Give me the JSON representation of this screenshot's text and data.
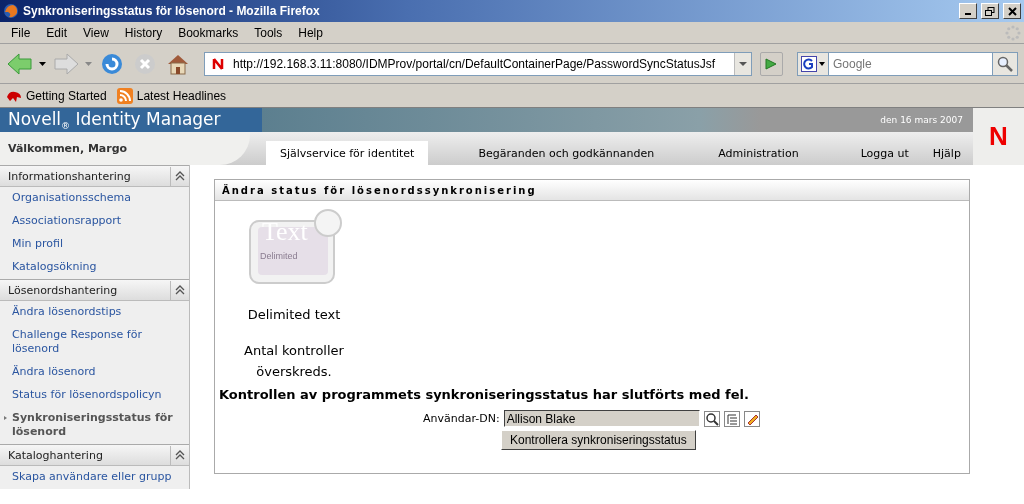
{
  "window": {
    "title": "Synkroniseringsstatus för lösenord - Mozilla Firefox"
  },
  "menu": [
    "File",
    "Edit",
    "View",
    "History",
    "Bookmarks",
    "Tools",
    "Help"
  ],
  "address": {
    "value": "http://192.168.3.11:8080/IDMProv/portal/cn/DefaultContainerPage/PasswordSyncStatusJsf"
  },
  "search": {
    "placeholder": "Google"
  },
  "bookmarks": [
    "Getting Started",
    "Latest Headlines"
  ],
  "header": {
    "product": "Novell$_{®}$ Identity Manager",
    "date": "den 16 mars 2007",
    "logo": "N"
  },
  "welcome": "Välkommen, Margo",
  "tabs": [
    {
      "label": "Självservice för identitet",
      "selected": true
    },
    {
      "label": "Begäranden och godkännanden",
      "selected": false
    },
    {
      "label": "Administration",
      "selected": false
    }
  ],
  "links": [
    "Logga ut",
    "Hjälp"
  ],
  "sidebar": [
    {
      "title": "Informationshantering",
      "items": [
        {
          "label": "Organisationsschema",
          "selected": false
        },
        {
          "label": "Associationsrapport",
          "selected": false
        },
        {
          "label": "Min profil",
          "selected": false
        },
        {
          "label": "Katalogsökning",
          "selected": false
        }
      ]
    },
    {
      "title": "Lösenordshantering",
      "items": [
        {
          "label": "Ändra lösenordstips",
          "selected": false
        },
        {
          "label": "Challenge Response för lösenord",
          "selected": false
        },
        {
          "label": "Ändra lösenord",
          "selected": false
        },
        {
          "label": "Status för lösenordspolicyn",
          "selected": false
        },
        {
          "label": "Synkroniseringsstatus för lösenord",
          "selected": true
        }
      ]
    },
    {
      "title": "Kataloghantering",
      "items": [
        {
          "label": "Skapa användare eller grupp",
          "selected": false
        }
      ]
    }
  ],
  "panel": {
    "title": "Ändra status för lösenordssynkronisering",
    "icon_texts": [
      "Text",
      "Delimited"
    ],
    "caption": "Delimited text",
    "message": "Antal kontroller överskreds.",
    "result": "Kontrollen av programmets synkroniseringsstatus har slutförts med fel.",
    "field_label": "Användar-DN:",
    "field_value": "Allison Blake",
    "button": "Kontrollera synkroniseringsstatus"
  }
}
